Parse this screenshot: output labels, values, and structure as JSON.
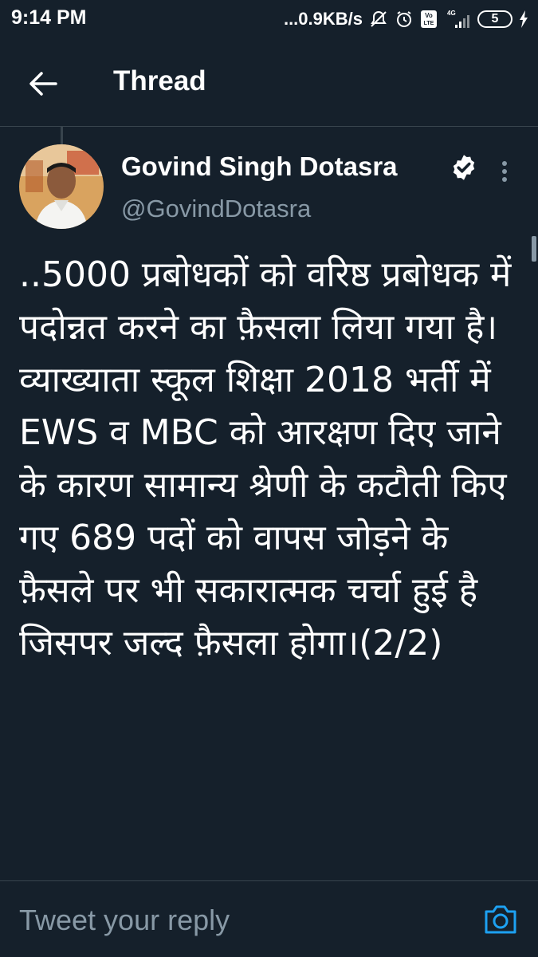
{
  "status_bar": {
    "time": "9:14 PM",
    "network_speed": "...0.9KB/s",
    "network_type": "4G",
    "battery_level": "5",
    "icons": [
      "dnd-off-icon",
      "alarm-icon",
      "volte-icon",
      "signal-icon",
      "battery-icon",
      "charging-icon"
    ]
  },
  "header": {
    "title": "Thread",
    "back_icon": "arrow-left-icon"
  },
  "tweet": {
    "author_name": "Govind Singh Dotasra",
    "author_handle": "@GovindDotasra",
    "verified": true,
    "text": "..5000 प्रबोधकों को वरिष्ठ प्रबोधक में पदोन्नत करने का फ़ैसला लिया गया है। व्याख्याता स्कूल शिक्षा 2018 भर्ती में EWS व MBC को आरक्षण दिए जाने के कारण सामान्य श्रेणी के कटौती किए गए 689 पदों को वापस जोड़ने के फ़ैसले पर भी सकारात्मक चर्चा हुई है जिसपर जल्द फ़ैसला होगा।(2/2)"
  },
  "reply": {
    "placeholder": "Tweet your reply",
    "camera_icon": "camera-icon"
  },
  "colors": {
    "background": "#15202b",
    "text": "#ffffff",
    "secondary_text": "#8899a6",
    "accent": "#1da1f2",
    "divider": "#38444d"
  }
}
